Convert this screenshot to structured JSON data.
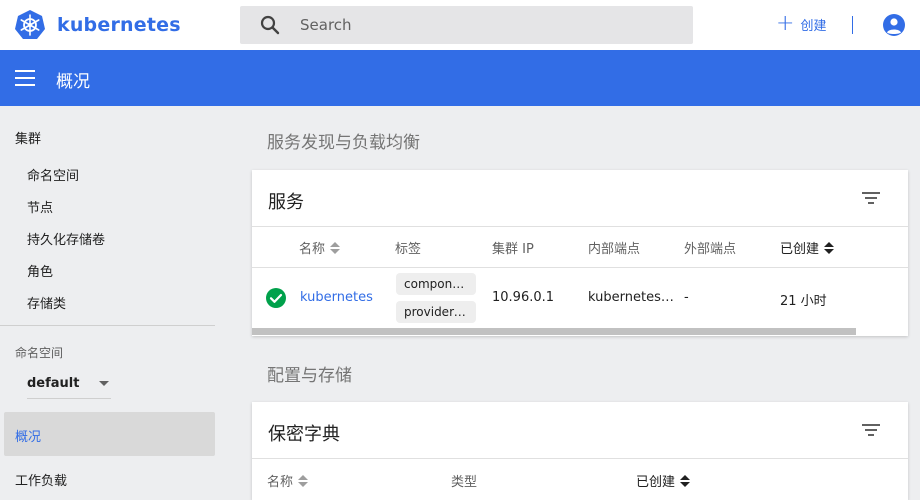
{
  "app": {
    "brand": "kubernetes"
  },
  "search": {
    "placeholder": "Search"
  },
  "toolbar": {
    "create_label": "创建"
  },
  "page": {
    "title": "概况"
  },
  "sidebar": {
    "cluster_label": "集群",
    "cluster_items": [
      "命名空间",
      "节点",
      "持久化存储卷",
      "角色",
      "存储类"
    ],
    "namespace_label": "命名空间",
    "namespace_value": "default",
    "overview_label": "概况",
    "workloads_label": "工作负载"
  },
  "main": {
    "section_discovery": "服务发现与负载均衡",
    "services_card": {
      "title": "服务",
      "headers": [
        "名称",
        "标签",
        "集群 IP",
        "内部端点",
        "外部端点",
        "已创建"
      ],
      "row": {
        "name": "kubernetes",
        "labels": [
          "component: apiserver",
          "provider: kubernetes"
        ],
        "cluster_ip": "10.96.0.1",
        "internal_endpoint": "kubernetes…",
        "external_endpoint": "-",
        "created": "21 小时"
      }
    },
    "section_config": "配置与存储",
    "secrets_card": {
      "title": "保密字典",
      "headers": [
        "名称",
        "类型",
        "已创建"
      ]
    }
  },
  "colors": {
    "brand": "#326de6",
    "success": "#00a14b",
    "background": "#edeef0"
  },
  "icons": {
    "logo": "kubernetes-helm-logo",
    "search": "search-icon",
    "plus": "plus-icon",
    "account": "account-circle-icon",
    "menu": "menu-icon",
    "filter": "filter-list-icon",
    "status": "check-circle-icon",
    "dropdown": "dropdown-caret-icon"
  }
}
